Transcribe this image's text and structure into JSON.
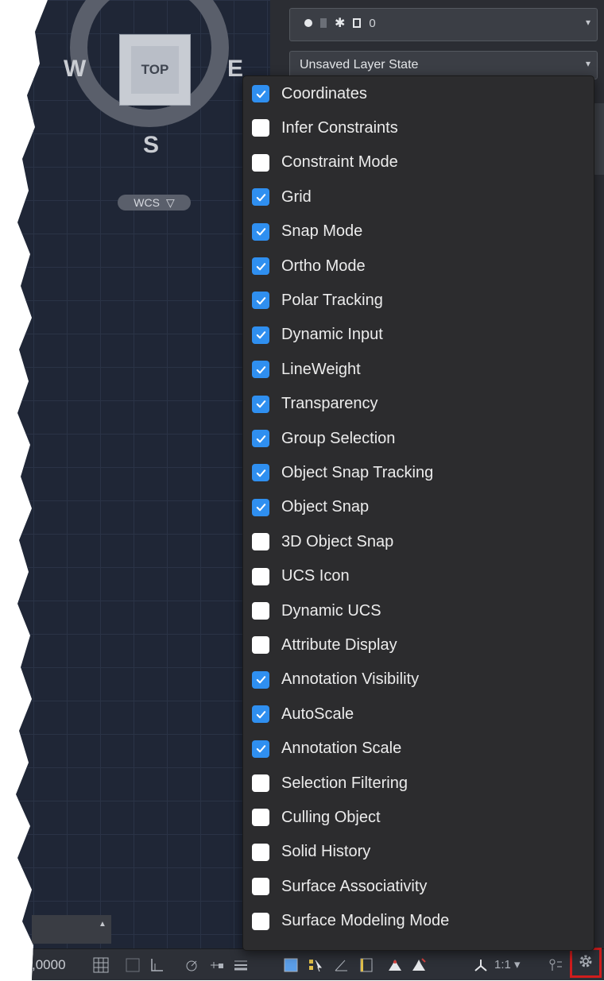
{
  "viewcube": {
    "top": "TOP",
    "west": "W",
    "east": "E",
    "south": "S",
    "wcs": "WCS"
  },
  "layer_panel": {
    "layer_name": "0",
    "layer_state": "Unsaved Layer State"
  },
  "menu": {
    "items": [
      {
        "label": "Coordinates",
        "checked": true
      },
      {
        "label": "Infer Constraints",
        "checked": false
      },
      {
        "label": "Constraint Mode",
        "checked": false
      },
      {
        "label": "Grid",
        "checked": true
      },
      {
        "label": "Snap Mode",
        "checked": true
      },
      {
        "label": "Ortho Mode",
        "checked": true
      },
      {
        "label": "Polar Tracking",
        "checked": true
      },
      {
        "label": "Dynamic Input",
        "checked": true
      },
      {
        "label": "LineWeight",
        "checked": true
      },
      {
        "label": "Transparency",
        "checked": true
      },
      {
        "label": "Group Selection",
        "checked": true
      },
      {
        "label": "Object Snap Tracking",
        "checked": true
      },
      {
        "label": "Object Snap",
        "checked": true
      },
      {
        "label": "3D Object Snap",
        "checked": false
      },
      {
        "label": "UCS Icon",
        "checked": false
      },
      {
        "label": "Dynamic UCS",
        "checked": false
      },
      {
        "label": "Attribute Display",
        "checked": false
      },
      {
        "label": "Annotation Visibility",
        "checked": true
      },
      {
        "label": "AutoScale",
        "checked": true
      },
      {
        "label": "Annotation Scale",
        "checked": true
      },
      {
        "label": "Selection Filtering",
        "checked": false
      },
      {
        "label": "Culling Object",
        "checked": false
      },
      {
        "label": "Solid History",
        "checked": false
      },
      {
        "label": "Surface Associativity",
        "checked": false
      },
      {
        "label": "Surface Modeling Mode",
        "checked": false
      }
    ]
  },
  "statusbar": {
    "coordinates": ",0000",
    "annotation_scale": "1:1"
  },
  "colors": {
    "checkbox_on": "#2f8ff0",
    "checkbox_off": "#ffffff",
    "menu_bg": "#2c2c2e",
    "viewport_bg": "#1f2636",
    "highlight_box": "#d11d1d"
  }
}
